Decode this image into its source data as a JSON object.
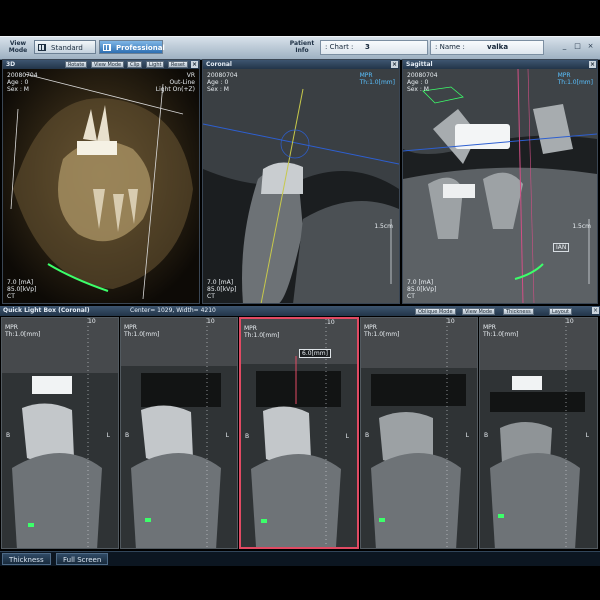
{
  "toolbar": {
    "view_mode_label": "View Mode",
    "standard_label": "Standard",
    "professional_label": "Professional",
    "patient_info_label": "Patient Info",
    "chart_label": ": Chart :",
    "chart_value": "3",
    "name_label": ": Name :",
    "name_value": "valka",
    "minimize": "_",
    "maximize": "□",
    "close": "×"
  },
  "panels": {
    "view3d": {
      "title": "3D",
      "buttons": [
        "Rotate",
        "View Mode",
        "Clip",
        "Light",
        "Reset"
      ],
      "info": "20080704\nAge : 0\nSex : M",
      "render": "VR\nOut-Line\nLight On(+Z)",
      "exposure": "7.0 [mA]\n85.0[kVp]\nCT"
    },
    "coronal": {
      "title": "Coronal",
      "info": "20080704\nAge : 0\nSex : M",
      "mpr": "MPR\nTh:1.0[mm]",
      "scale": "1.5cm",
      "exposure": "7.0 [mA]\n85.0[kVp]\nCT"
    },
    "sagittal": {
      "title": "Sagittal",
      "info": "20080704\nAge : 0\nSex : M",
      "mpr": "MPR\nTh:1.0[mm]",
      "scale": "1.5cm",
      "nerve_label": "IAN",
      "exposure": "7.0 [mA]\n85.0[kVp]\nCT"
    }
  },
  "lightbox": {
    "title": "Quick Light Box (Coronal)",
    "window": "Center= 1029, Width= 4210",
    "buttons": [
      "Oblique Mode",
      "View Mode",
      "Thickness",
      "Layout"
    ],
    "slices": [
      {
        "mpr": "MPR\nTh:1.0[mm]",
        "left": "B",
        "right": "L",
        "ruler": "10"
      },
      {
        "mpr": "MPR\nTh:1.0[mm]",
        "left": "B",
        "right": "L",
        "ruler": "10"
      },
      {
        "mpr": "MPR\nTh:1.0[mm]",
        "left": "B",
        "right": "L",
        "ruler": "10",
        "measure": "6.0[mm]"
      },
      {
        "mpr": "MPR\nTh:1.0[mm]",
        "left": "B",
        "right": "L",
        "ruler": "10"
      },
      {
        "mpr": "MPR\nTh:1.0[mm]",
        "left": "B",
        "right": "L",
        "ruler": "10"
      }
    ]
  },
  "bottom_tabs": [
    "Thickness",
    "Full Screen"
  ],
  "colors": {
    "accent": "#2e6fb2",
    "selection": "#e14a63",
    "nerve": "#3cff6a",
    "overlay_text": "#59c1ff"
  }
}
